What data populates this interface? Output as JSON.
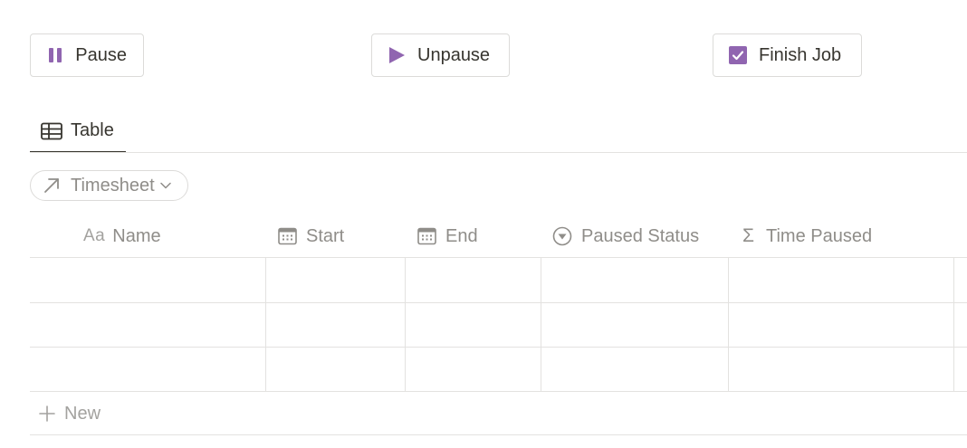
{
  "actions": {
    "pause_label": "Pause",
    "unpause_label": "Unpause",
    "finish_label": "Finish Job"
  },
  "view": {
    "tab_label": "Table"
  },
  "filter": {
    "pill_label": "Timesheet"
  },
  "table": {
    "name_type_glyph": "Aa",
    "sigma_glyph": "Σ",
    "columns": [
      "Name",
      "Start",
      "End",
      "Paused Status",
      "Time Paused"
    ],
    "rows": [
      [
        "",
        "",
        "",
        "",
        ""
      ],
      [
        "",
        "",
        "",
        "",
        ""
      ],
      [
        "",
        "",
        "",
        "",
        ""
      ]
    ],
    "new_label": "New"
  },
  "colors": {
    "accent": "#9065b0",
    "text": "#37352f",
    "muted": "#8f8d89",
    "border": "#e3e2e0"
  }
}
